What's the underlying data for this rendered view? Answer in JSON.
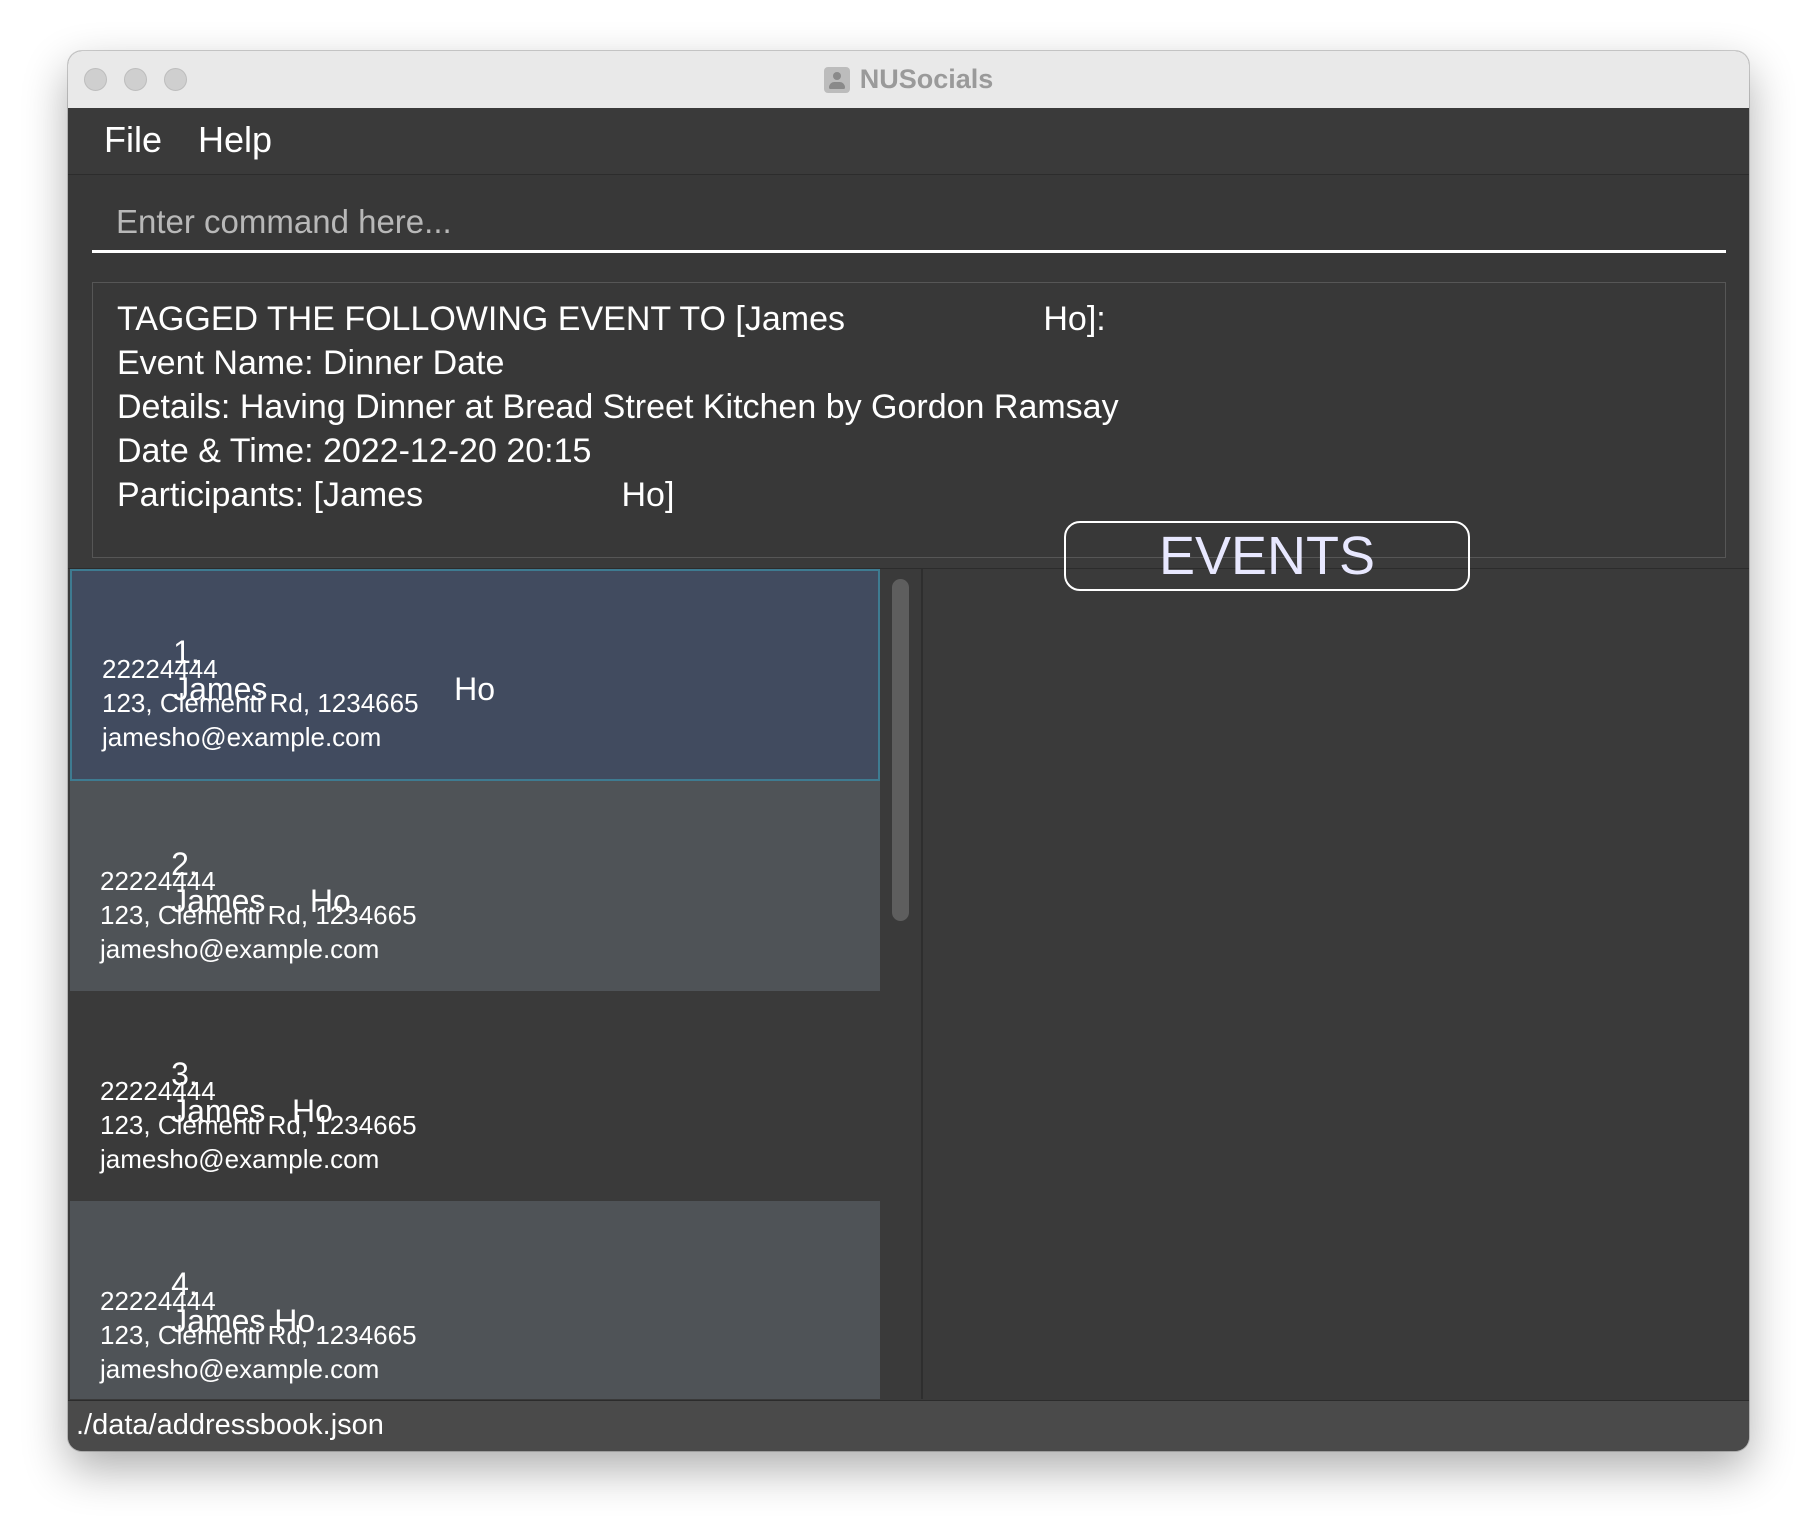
{
  "window": {
    "title": "NUSocials"
  },
  "menu": {
    "file_label": "File",
    "help_label": "Help"
  },
  "command": {
    "placeholder": "Enter command here..."
  },
  "result": {
    "lines": [
      "TAGGED THE FOLLOWING EVENT TO [James                     Ho]:",
      "Event Name: Dinner Date",
      "Details: Having Dinner at Bread Street Kitchen by Gordon Ramsay",
      "Date & Time: 2022-12-20 20:15",
      "Participants: [James                     Ho]"
    ]
  },
  "persons": [
    {
      "index": "1.",
      "name": "James                     Ho",
      "phone": "22224444",
      "address": "123, Clementi Rd, 1234665",
      "email": "jamesho@example.com"
    },
    {
      "index": "2.",
      "name": "James     Ho",
      "phone": "22224444",
      "address": "123, Clementi Rd, 1234665",
      "email": "jamesho@example.com"
    },
    {
      "index": "3.",
      "name": "James   Ho",
      "phone": "22224444",
      "address": "123, Clementi Rd, 1234665",
      "email": "jamesho@example.com"
    },
    {
      "index": "4.",
      "name": "James Ho",
      "phone": "22224444",
      "address": "123, Clementi Rd, 1234665",
      "email": "jamesho@example.com"
    }
  ],
  "events_panel": {
    "button_label": "EVENTS"
  },
  "status": {
    "file_path": "./data/addressbook.json"
  },
  "colors": {
    "window_bg": "#3a3a3a",
    "selected_card": "#414b5f",
    "selected_border": "#3e7b91",
    "alt_card": "#4f5357",
    "text": "#ffffff"
  }
}
